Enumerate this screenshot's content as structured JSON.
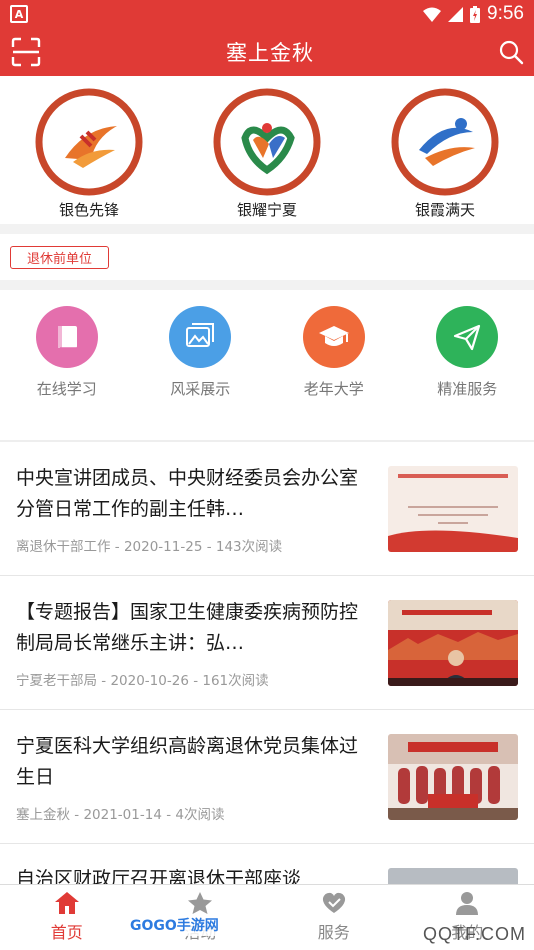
{
  "status_bar": {
    "time": "9:56",
    "app_badge": "A"
  },
  "app_bar": {
    "title": "塞上金秋"
  },
  "featured": [
    {
      "label": "银色先锋",
      "seal_text": "银色先锋"
    },
    {
      "label": "银耀宁夏",
      "seal_text": "银耀宁夏"
    },
    {
      "label": "银霞满天",
      "seal_text": "银霞满天"
    }
  ],
  "unit_tag": "退休前单位",
  "services": [
    {
      "label": "在线学习",
      "color": "#e46fad",
      "icon": "book-icon"
    },
    {
      "label": "风采展示",
      "color": "#4b9fe6",
      "icon": "gallery-icon"
    },
    {
      "label": "老年大学",
      "color": "#ef6a3a",
      "icon": "graduation-cap-icon"
    },
    {
      "label": "精准服务",
      "color": "#2eb35a",
      "icon": "send-icon"
    }
  ],
  "news": [
    {
      "title": "中央宣讲团成员、中央财经委员会办公室分管日常工作的副主任韩…",
      "meta": "离退休干部工作 - 2020-11-25 - 143次阅读"
    },
    {
      "title": "【专题报告】国家卫生健康委疾病预防控制局局长常继乐主讲：弘…",
      "meta": "宁夏老干部局 - 2020-10-26 - 161次阅读"
    },
    {
      "title": "宁夏医科大学组织高龄离退休党员集体过生日",
      "meta": "塞上金秋 - 2021-01-14 - 4次阅读"
    }
  ],
  "partial_news_title": "自治区财政厅召开离退休干部座谈",
  "tabs": [
    {
      "label": "首页",
      "icon": "home-icon",
      "active": true
    },
    {
      "label": "活动",
      "icon": "star-icon",
      "active": false
    },
    {
      "label": "服务",
      "icon": "heart-icon",
      "active": false
    },
    {
      "label": "我的",
      "icon": "user-icon",
      "active": false
    }
  ],
  "watermarks": {
    "left": "GOGO手游网",
    "right": "QQTF.COM"
  },
  "colors": {
    "brand_red": "#e03a36"
  }
}
